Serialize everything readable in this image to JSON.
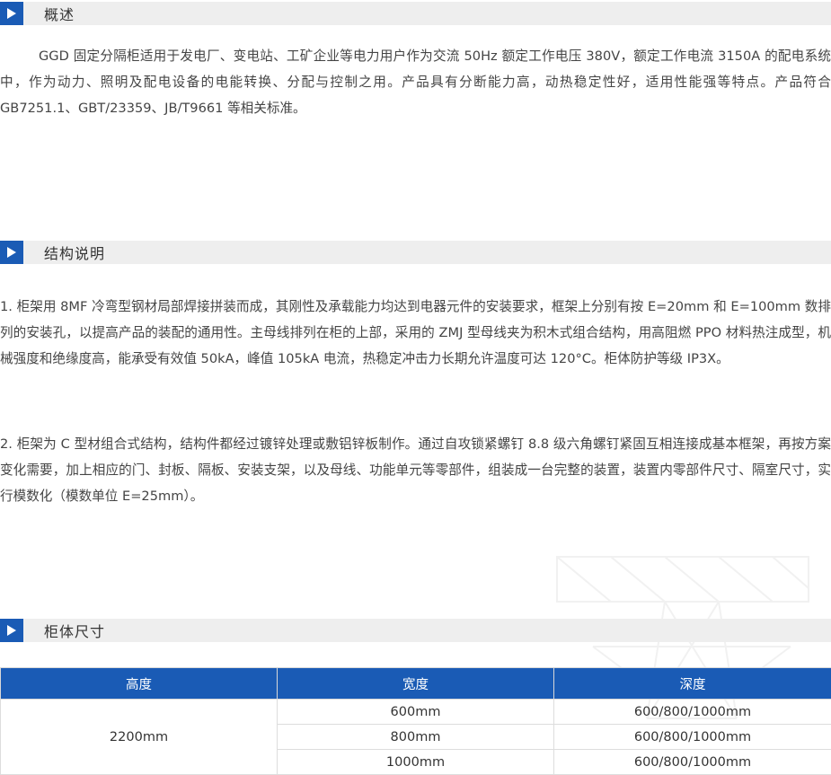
{
  "overview": {
    "title": "概述",
    "body": "GGD 固定分隔柜适用于发电厂、变电站、工矿企业等电力用户作为交流 50Hz 额定工作电压 380V，额定工作电流 3150A 的配电系统中，作为动力、照明及配电设备的电能转换、分配与控制之用。产品具有分断能力高，动热稳定性好，适用性能强等特点。产品符合 GB7251.1、GBT/23359、JB/T9661 等相关标准。"
  },
  "structure": {
    "title": "结构说明",
    "items": [
      "1. 柜架用 8MF 冷弯型钢材局部焊接拼装而成，其刚性及承载能力均达到电器元件的安装要求，框架上分别有按 E=20mm 和 E=100mm 数排列的安装孔，以提高产品的装配的通用性。主母线排列在柜的上部，采用的 ZMJ 型母线夹为积木式组合结构，用高阻燃 PPO 材料热注成型，机械强度和绝缘度高，能承受有效值 50kA，峰值 105kA 电流，热稳定冲击力长期允许温度可达 120°C。柜体防护等级 IP3X。",
      "2. 柜架为 C 型材组合式结构，结构件都经过镀锌处理或敷铝锌板制作。通过自攻锁紧螺钉 8.8 级六角螺钉紧固互相连接成基本框架，再按方案变化需要，加上相应的门、封板、隔板、安装支架，以及母线、功能单元等零部件，组装成一台完整的装置，装置内零部件尺寸、隔室尺寸，实行模数化（模数单位 E=25mm）。"
    ]
  },
  "dimensions": {
    "title": "柜体尺寸",
    "headers": [
      "高度",
      "宽度",
      "深度"
    ],
    "height_value": "2200mm",
    "rows": [
      {
        "width": "600mm",
        "depth": "600/800/1000mm"
      },
      {
        "width": "800mm",
        "depth": "600/800/1000mm"
      },
      {
        "width": "1000mm",
        "depth": "600/800/1000mm"
      }
    ]
  },
  "colors": {
    "accent": "#1a5bb5",
    "header_bar": "#eeeeee",
    "text": "#444444"
  },
  "icons": {
    "section_marker": "play-triangle-icon"
  }
}
